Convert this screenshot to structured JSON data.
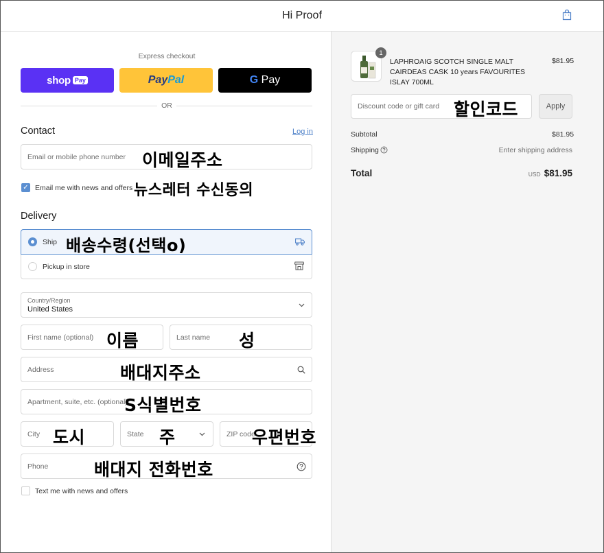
{
  "header": {
    "brand": "Hi Proof",
    "cart_icon": "shopping-bag-icon"
  },
  "express": {
    "label": "Express checkout",
    "shop_pay": {
      "logo": "shop",
      "badge": "Pay"
    },
    "paypal": {
      "part1": "Pay",
      "part2": "Pal"
    },
    "gpay": {
      "g": "G",
      "label": "Pay"
    },
    "or": "OR"
  },
  "contact": {
    "title": "Contact",
    "login": "Log in",
    "email_placeholder": "Email or mobile phone number",
    "email_note": "이메일주소",
    "news_checkbox_checked": true,
    "news_label": "Email me with news and offers",
    "news_note": "뉴스레터 수신동의"
  },
  "delivery": {
    "title": "Delivery",
    "ship_label": "Ship",
    "ship_note": "배송수령(선택o)",
    "pickup_label": "Pickup in store",
    "country_label": "Country/Region",
    "country_value": "United States",
    "first_name_placeholder": "First name (optional)",
    "first_name_note": "이름",
    "last_name_placeholder": "Last name",
    "last_name_note": "성",
    "address_placeholder": "Address",
    "address_note": "배대지주소",
    "apartment_placeholder": "Apartment, suite, etc. (optional)",
    "apartment_note": "S식별번호",
    "city_placeholder": "City",
    "city_note": "도시",
    "state_placeholder": "State",
    "state_note": "주",
    "zip_placeholder": "ZIP code",
    "zip_note": "우편번호",
    "phone_placeholder": "Phone",
    "phone_note": "배대지 전화번호",
    "text_checkbox_checked": false,
    "text_label": "Text me with news and offers"
  },
  "summary": {
    "quantity_badge": "1",
    "product_name": "LAPHROAIG SCOTCH SINGLE MALT CAIRDEAS CASK 10 years FAVOURITES ISLAY 700ML",
    "product_price": "$81.95",
    "discount_placeholder": "Discount code or gift card",
    "discount_note": "할인코드",
    "apply_label": "Apply",
    "subtotal_label": "Subtotal",
    "subtotal_value": "$81.95",
    "shipping_label": "Shipping",
    "shipping_value": "Enter shipping address",
    "total_label": "Total",
    "total_currency": "USD",
    "total_value": "$81.95"
  },
  "colors": {
    "accent": "#5b8fd1",
    "shop_pay": "#5a31f4",
    "paypal": "#ffc439",
    "gpay": "#000000",
    "summary_bg": "#f5f5f5"
  }
}
